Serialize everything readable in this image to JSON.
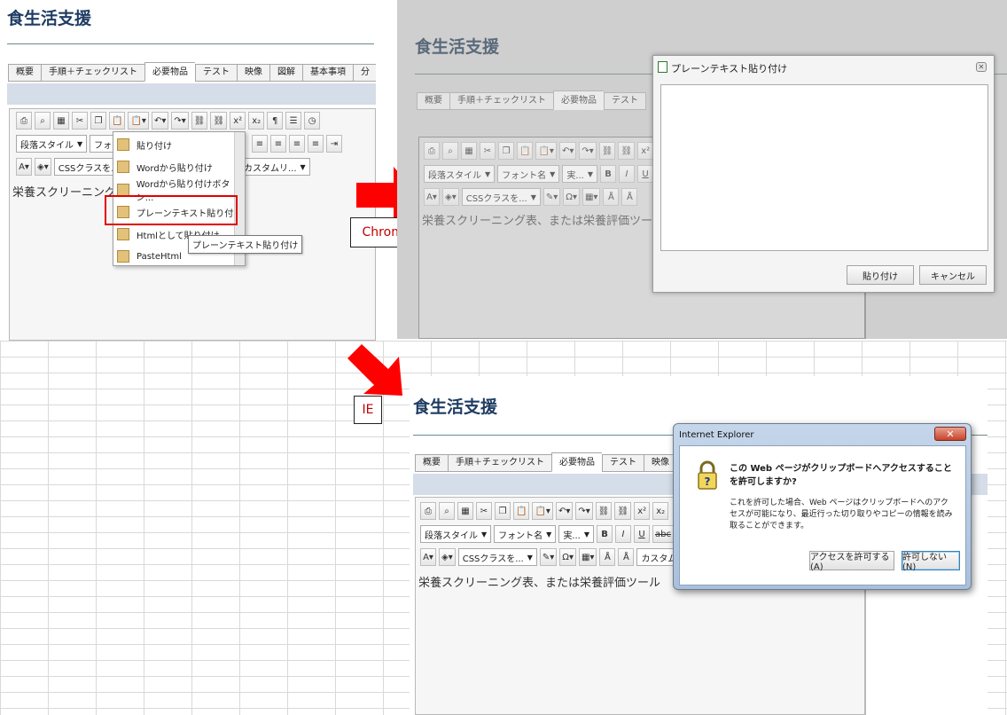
{
  "app_title": "食生活支援",
  "tabs": [
    "概要",
    "手順＋チェックリスト",
    "必要物品",
    "テスト",
    "映像",
    "図解",
    "基本事項",
    "分"
  ],
  "editor": {
    "para_style": "段落スタイル",
    "font_name_short": "フォント",
    "font_name": "フォント名",
    "font_size_short": "実...",
    "css_class": "CSSクラスを...",
    "custom_links": "カスタムリ...",
    "custom_short": "カスタム",
    "content_text": "栄養スクリーニング表、または栄養評価ツール",
    "content_text_short": "栄養スクリーニング表"
  },
  "paste_menu": {
    "items": [
      "貼り付け",
      "Wordから貼り付け",
      "Wordから貼り付けボタン...",
      "プレーンテキスト貼り付け",
      "Htmlとして貼り付け",
      "PasteHtml"
    ],
    "tooltip": "プレーンテキスト貼り付け"
  },
  "labels": {
    "chrome": "Chrome",
    "ie": "IE"
  },
  "chrome_dialog": {
    "title": "プレーンテキスト貼り付け",
    "paste_button": "貼り付け",
    "cancel_button": "キャンセル"
  },
  "ie_dialog": {
    "title": "Internet Explorer",
    "question": "この Web ページがクリップボードへアクセスすることを許可しますか?",
    "body": "これを許可した場合、Web ページはクリップボードへのアクセスが可能になり、最近行った切り取りやコピーの情報を読み取ることができます。",
    "allow_button": "アクセスを許可する(A)",
    "deny_button": "許可しない(N)"
  },
  "colors": {
    "title": "#1f3c63",
    "accent_red": "#e00000",
    "tab_bar": "#d4dde8"
  }
}
